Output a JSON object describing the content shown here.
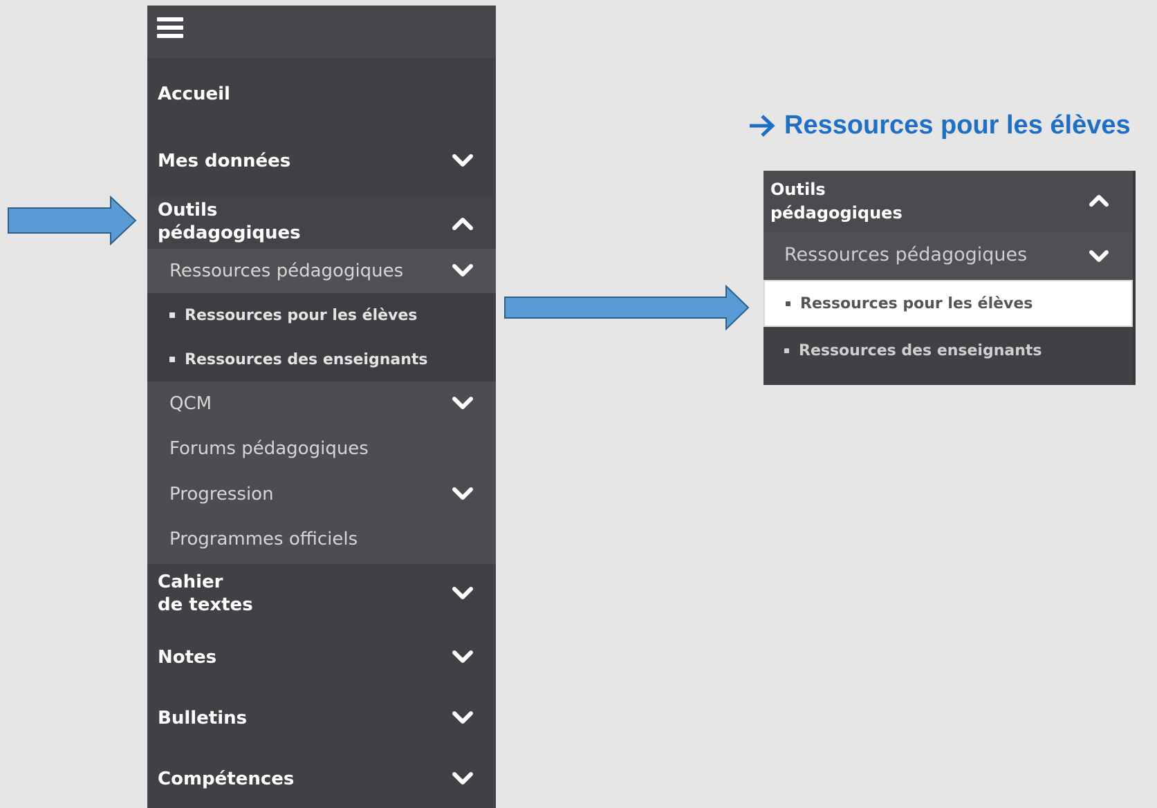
{
  "sidebar": {
    "home": "Accueil",
    "my_data": "Mes données",
    "tools_line1": "Outils",
    "tools_line2": "pédagogiques",
    "sub": {
      "resources": "Ressources pédagogiques",
      "resources_students": "Ressources pour les élèves",
      "resources_teachers": "Ressources des enseignants",
      "qcm": "QCM",
      "forums": "Forums pédagogiques",
      "progression": "Progression",
      "programmes": "Programmes officiels"
    },
    "notebook_line1": "Cahier",
    "notebook_line2": "de textes",
    "notes": "Notes",
    "bulletins": "Bulletins",
    "skills": "Compétences"
  },
  "callout": {
    "heading": "Ressources pour les élèves"
  },
  "zoom": {
    "title_line1": "Outils",
    "title_line2": "pédagogiques",
    "sub": "Ressources pédagogiques",
    "active_item": "Ressources pour les élèves",
    "item2": "Ressources des enseignants"
  },
  "colors": {
    "sidebar_bg": "#404145",
    "arrow_fill": "#5b9bd5",
    "arrow_stroke": "#2e5f8a",
    "heading_blue": "#1f6fc5"
  },
  "icons": {
    "menu": "hamburger-icon",
    "expand": "chevron-down-icon",
    "collapse": "chevron-up-icon",
    "pointer": "arrow-right-icon"
  }
}
